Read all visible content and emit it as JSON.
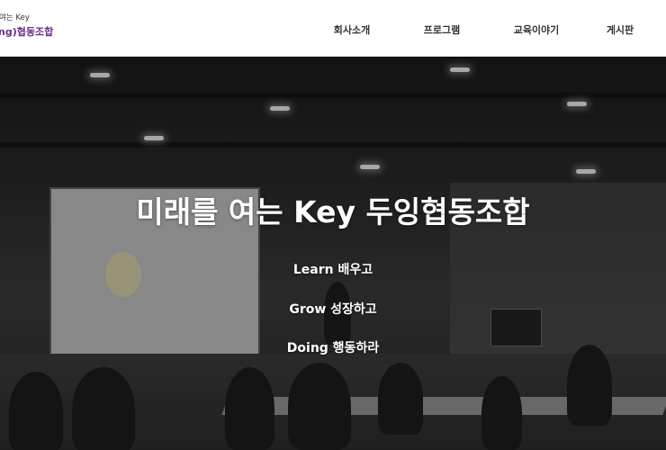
{
  "header": {
    "logo": {
      "tagline": "여는 Key",
      "brand": "ng)협동조합"
    },
    "nav": [
      {
        "label": "회사소개"
      },
      {
        "label": "프로그램"
      },
      {
        "label": "교육이야기"
      },
      {
        "label": "게시판"
      }
    ]
  },
  "hero": {
    "headline": "미래를 여는 Key 두잉협동조합",
    "mottos": [
      "Learn 배우고",
      "Grow 성장하고",
      "Doing 행동하라"
    ]
  },
  "colors": {
    "brand": "#6a2e8c",
    "nav_text": "#333333",
    "hero_text": "#ffffff"
  }
}
